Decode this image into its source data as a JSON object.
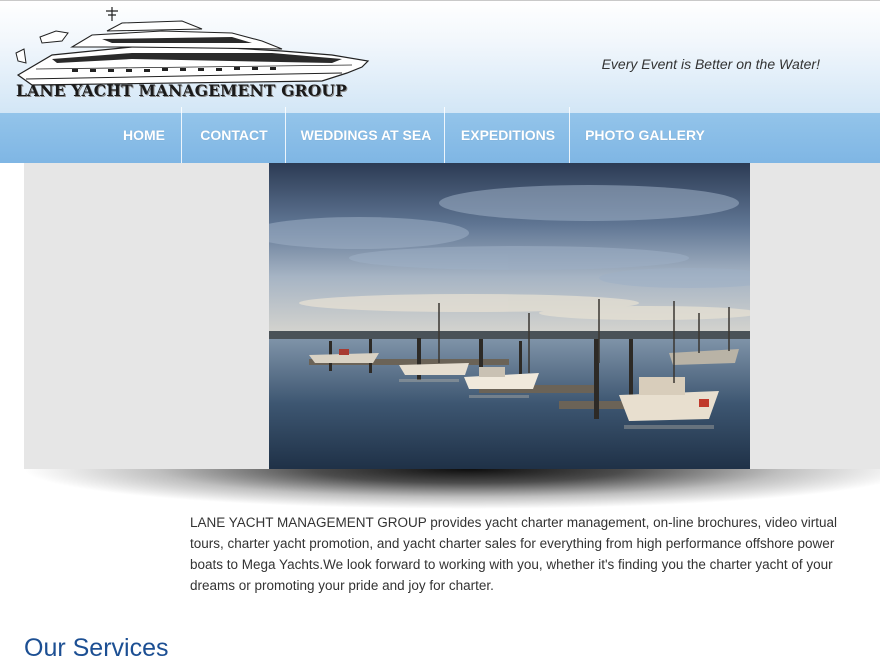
{
  "header": {
    "brand": "LANE YACHT MANAGEMENT GROUP",
    "tagline": "Every Event is Better on the Water!"
  },
  "nav": {
    "items": [
      {
        "label": "HOME"
      },
      {
        "label": "CONTACT"
      },
      {
        "label": "WEDDINGS AT SEA"
      },
      {
        "label": "EXPEDITIONS"
      },
      {
        "label": "PHOTO GALLERY"
      }
    ]
  },
  "intro": {
    "text": "LANE YACHT MANAGEMENT GROUP provides yacht charter management, on-line brochures, video virtual tours, charter yacht promotion, and yacht charter sales for everything from high performance offshore power boats to Mega Yachts.We look forward to working with you, whether it's finding you the charter yacht of your dreams or promoting your pride and joy for charter."
  },
  "services": {
    "title": "Our Services"
  },
  "colors": {
    "nav_bg": "#88bde7",
    "heading": "#1c4f93",
    "body_text": "#333333"
  }
}
